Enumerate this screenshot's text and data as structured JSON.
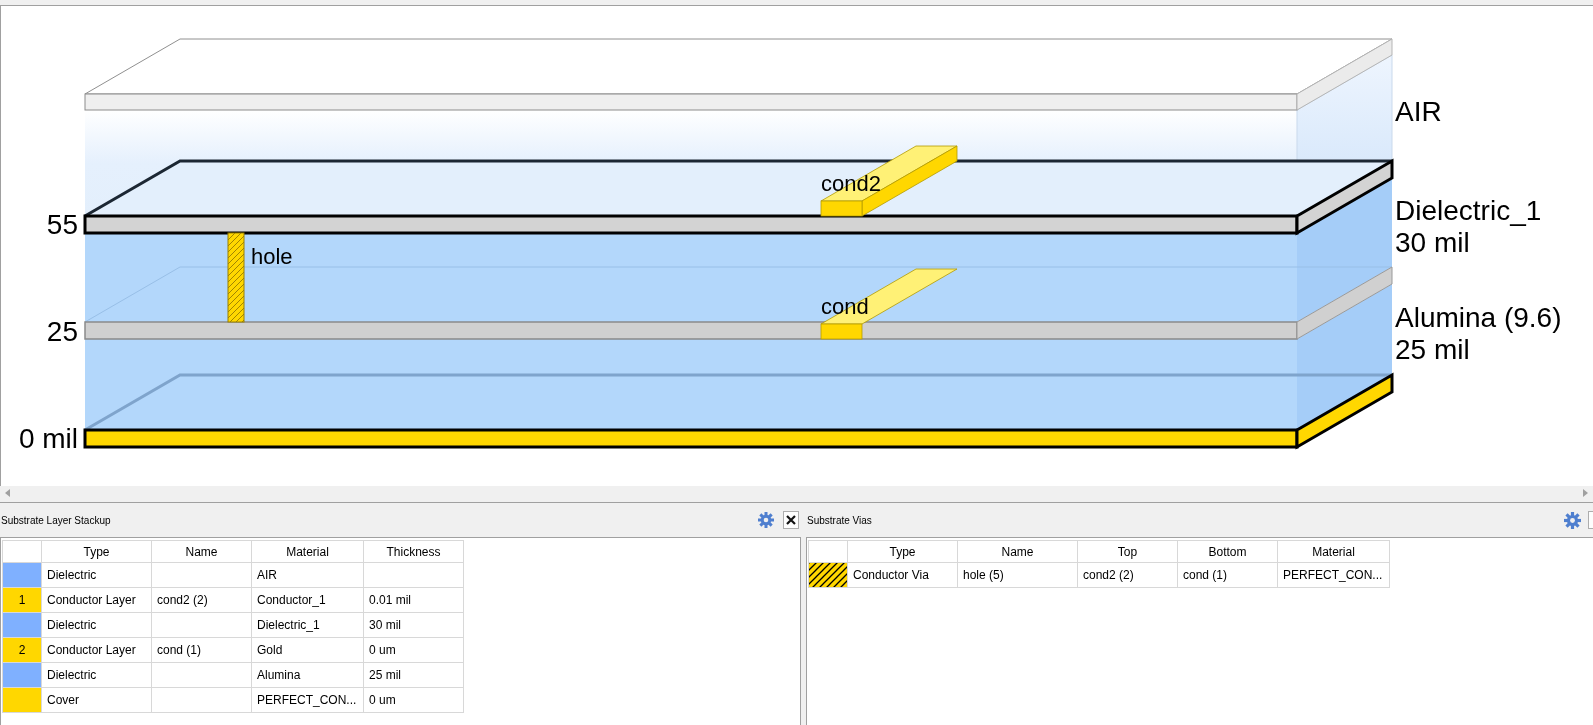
{
  "view": {
    "height_labels": [
      "55",
      "25",
      "0 mil"
    ],
    "layer_labels": [
      {
        "name": "AIR"
      },
      {
        "name": "Dielectric_1",
        "thickness": "30 mil"
      },
      {
        "name": "Alumina (9.6)",
        "thickness": "25 mil"
      }
    ],
    "traces": [
      {
        "label": "cond2"
      },
      {
        "label": "cond"
      }
    ],
    "via": {
      "label": "hole"
    }
  },
  "layer_stackup": {
    "title": "Substrate Layer Stackup",
    "columns": [
      "Type",
      "Name",
      "Material",
      "Thickness"
    ],
    "rows": [
      {
        "color": "#7fb0ff",
        "type": "Dielectric",
        "material": "AIR"
      },
      {
        "color": "#ffd700",
        "number": "1",
        "type": "Conductor Layer",
        "name": "cond2 (2)",
        "material": "Conductor_1",
        "thickness": "0.01 mil"
      },
      {
        "color": "#7fb0ff",
        "type": "Dielectric",
        "material": "Dielectric_1",
        "thickness": "30 mil"
      },
      {
        "color": "#ffd700",
        "number": "2",
        "type": "Conductor Layer",
        "name": "cond (1)",
        "material": "Gold",
        "thickness": "0 um"
      },
      {
        "color": "#7fb0ff",
        "type": "Dielectric",
        "material": "Alumina",
        "thickness": "25 mil"
      },
      {
        "color": "#ffd700",
        "type": "Cover",
        "material": "PERFECT_CON...",
        "thickness": "0 um"
      }
    ]
  },
  "vias": {
    "title": "Substrate Vias",
    "columns": [
      "Type",
      "Name",
      "Top",
      "Bottom",
      "Material"
    ],
    "rows": [
      {
        "type": "Conductor Via",
        "name": "hole (5)",
        "top": "cond2 (2)",
        "bottom": "cond (1)",
        "material": "PERFECT_CON..."
      }
    ]
  }
}
